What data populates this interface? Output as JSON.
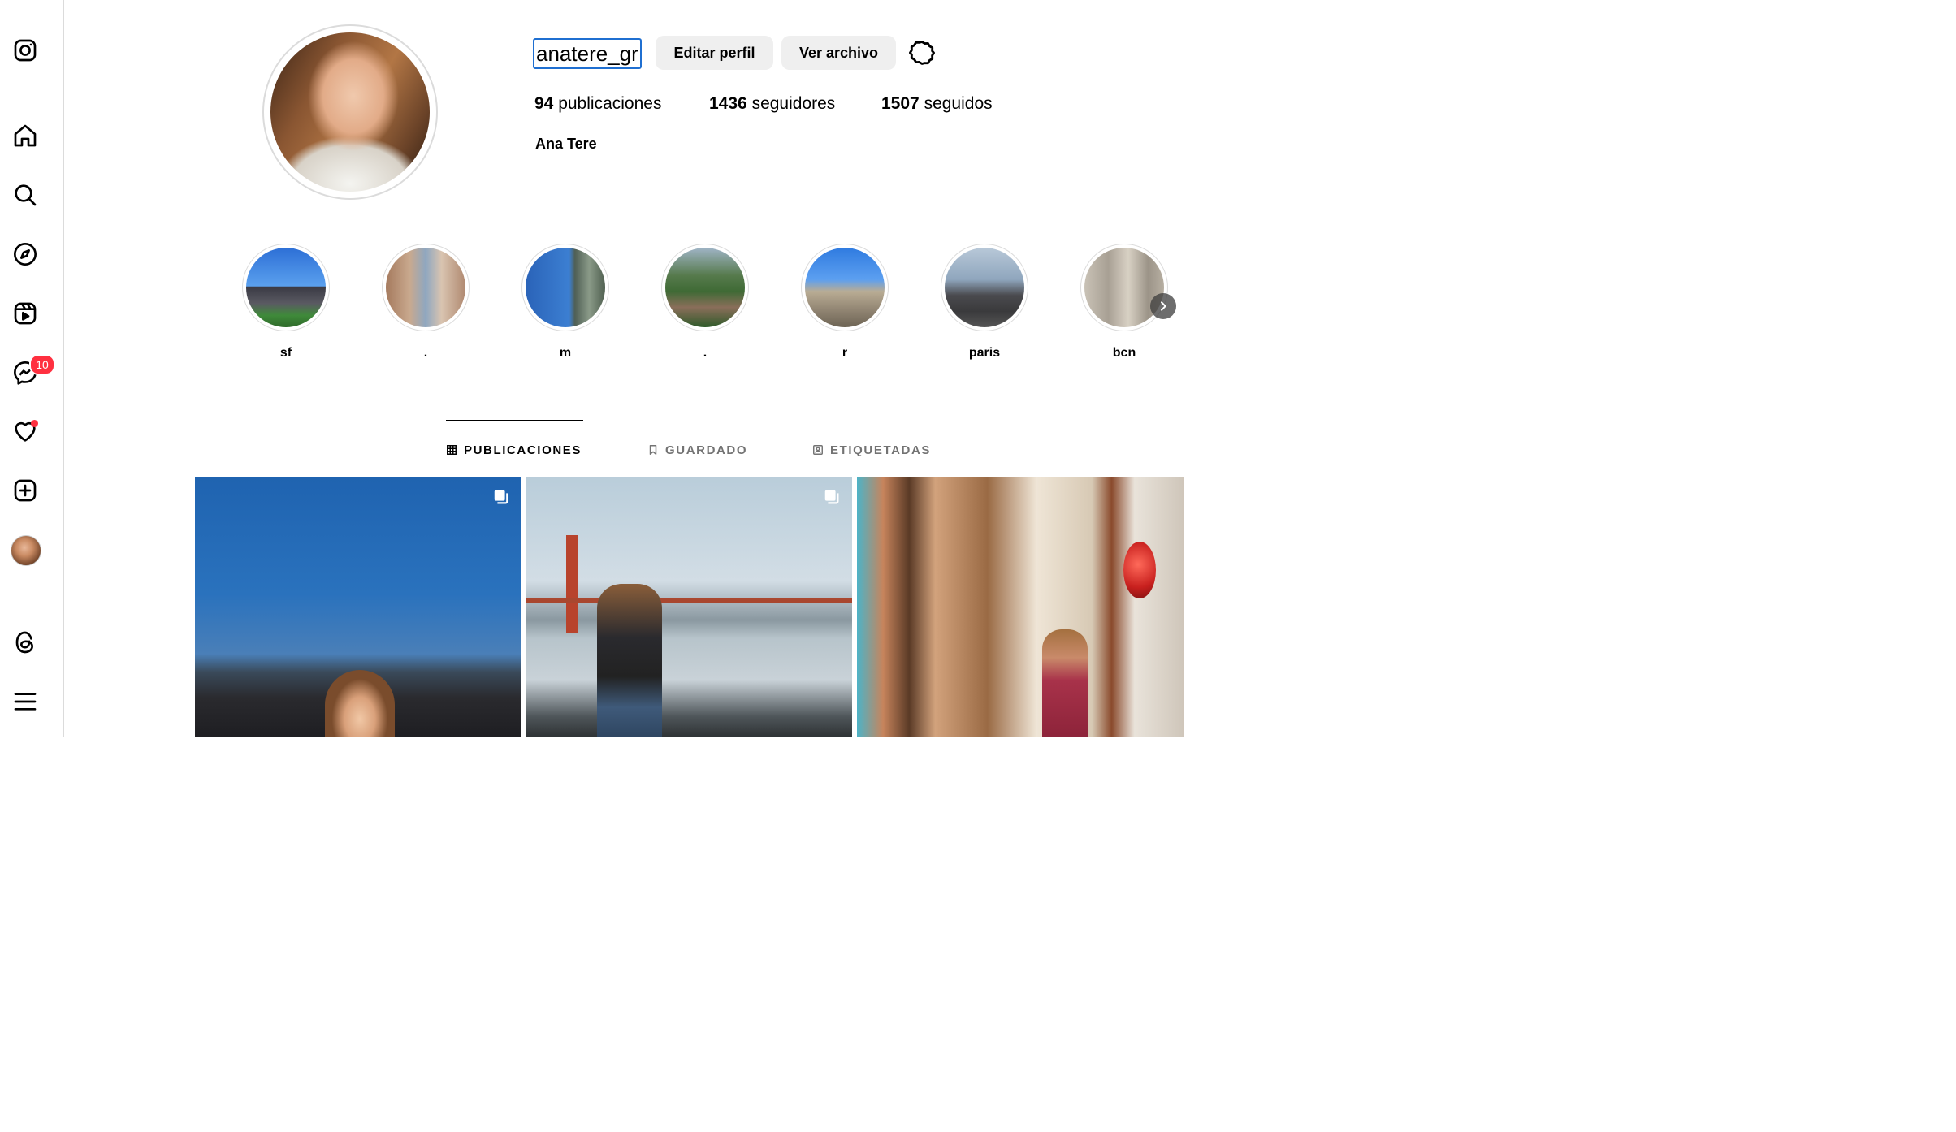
{
  "profile": {
    "username": "anatere_gr",
    "edit_label": "Editar perfil",
    "archive_label": "Ver archivo",
    "posts_count": "94",
    "posts_label": "publicaciones",
    "followers_count": "1436",
    "followers_label": "seguidores",
    "following_count": "1507",
    "following_label": "seguidos",
    "full_name": "Ana Tere"
  },
  "sidebar": {
    "messages_badge": "10",
    "icons": [
      "instagram-logo-icon",
      "home-icon",
      "search-icon",
      "explore-icon",
      "reels-icon",
      "messenger-icon",
      "heart-icon",
      "create-icon",
      "profile-avatar",
      "threads-icon",
      "menu-icon"
    ]
  },
  "highlights": [
    {
      "label": "sf"
    },
    {
      "label": "."
    },
    {
      "label": "m"
    },
    {
      "label": "."
    },
    {
      "label": "r"
    },
    {
      "label": "paris"
    },
    {
      "label": "bcn"
    }
  ],
  "tabs": [
    {
      "label": "PUBLICACIONES",
      "active": true
    },
    {
      "label": "GUARDADO",
      "active": false
    },
    {
      "label": "ETIQUETADAS",
      "active": false
    }
  ],
  "colors": {
    "badge": "#ff3040",
    "username_focus": "#1f6fd1",
    "button_bg": "#efefef",
    "border": "#dbdbdb"
  }
}
